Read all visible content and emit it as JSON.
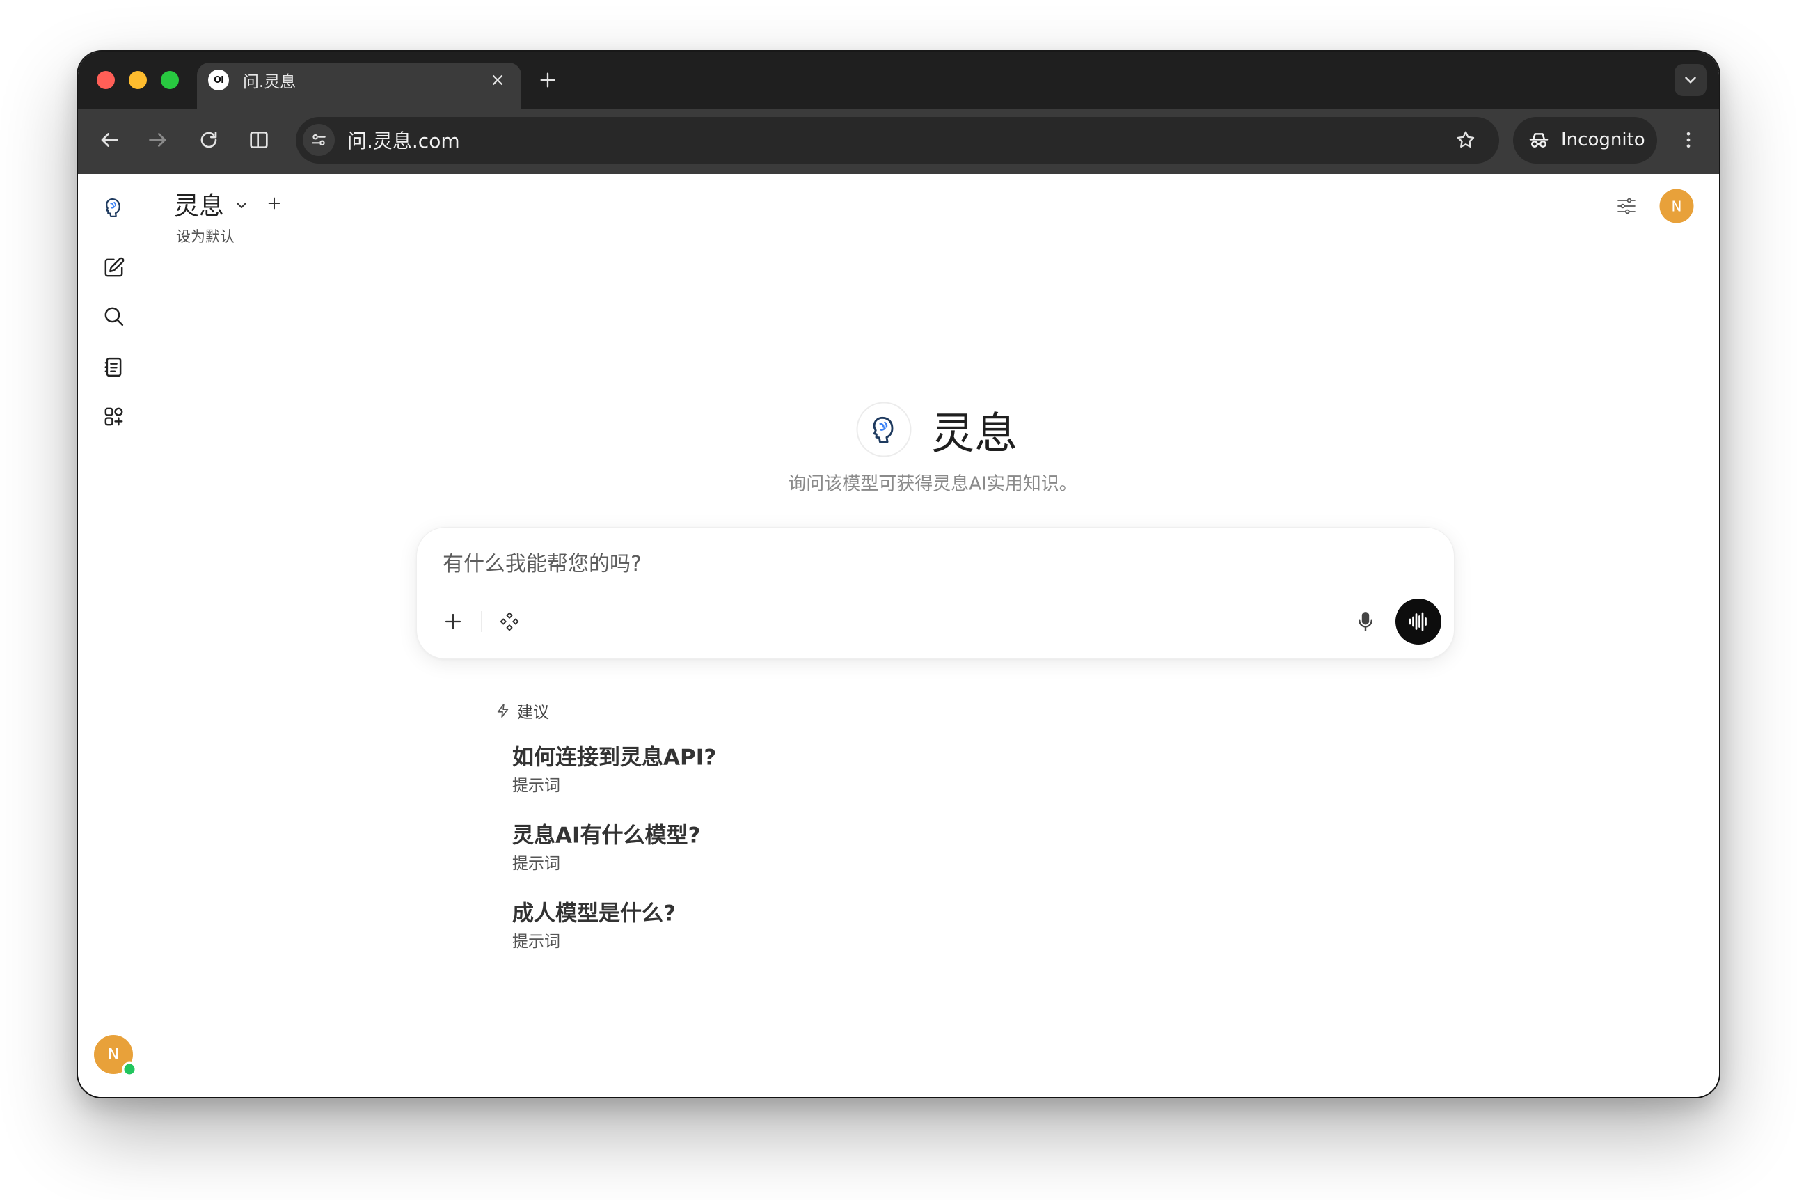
{
  "browser": {
    "tab_title": "问.灵息",
    "favicon_text": "OI",
    "url": "问.灵息.com",
    "incognito_label": "Incognito"
  },
  "header": {
    "model_name": "灵息",
    "set_default": "设为默认",
    "avatar_initial": "N"
  },
  "sidebar": {
    "avatar_initial": "N",
    "status": "online"
  },
  "hero": {
    "title": "灵息",
    "subtitle": "询问该模型可获得灵息AI实用知识。"
  },
  "composer": {
    "placeholder": "有什么我能帮您的吗?"
  },
  "suggestions": {
    "label": "建议",
    "items": [
      {
        "title": "如何连接到灵息API?",
        "subtitle": "提示词"
      },
      {
        "title": "灵息AI有什么模型?",
        "subtitle": "提示词"
      },
      {
        "title": "成人模型是什么?",
        "subtitle": "提示词"
      }
    ]
  },
  "icons": {
    "browser": [
      "back-arrow-icon",
      "forward-arrow-icon",
      "reload-icon",
      "split-view-icon",
      "site-info-icon",
      "star-icon",
      "incognito-icon",
      "kebab-menu-icon"
    ],
    "sidebar": [
      "logo-icon",
      "new-chat-icon",
      "search-icon",
      "notes-icon",
      "workspace-icon"
    ],
    "composer": [
      "plus-icon",
      "tools-icon",
      "mic-icon",
      "waveform-icon"
    ],
    "suggestions": "lightning-icon"
  },
  "colors": {
    "tab_strip": "#1f1f1f",
    "toolbar": "#3b3b3b",
    "omnibox": "#282828",
    "avatar": "#e8a13a",
    "online": "#22c55e",
    "logo_navy": "#1e3a5f",
    "logo_blue": "#3b82f6",
    "voice_button": "#0d0d0d"
  }
}
